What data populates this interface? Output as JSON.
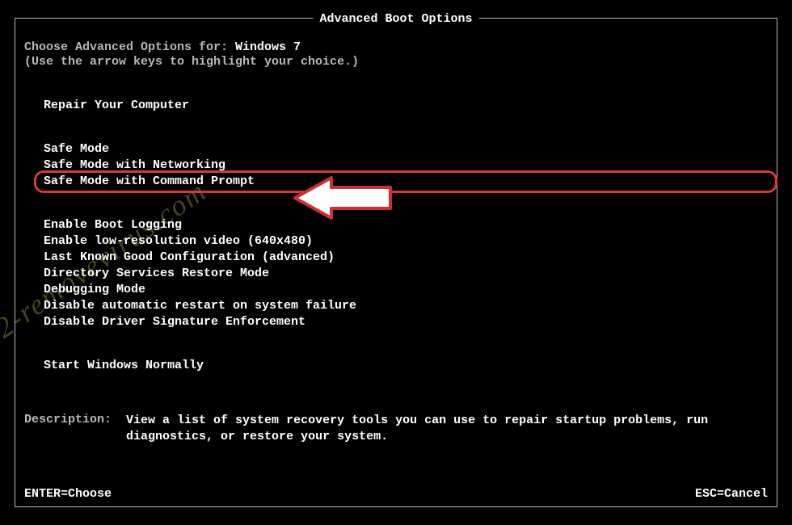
{
  "title": "Advanced Boot Options",
  "prompt": {
    "prefix": "Choose Advanced Options for: ",
    "os": "Windows 7",
    "hint": "(Use the arrow keys to highlight your choice.)"
  },
  "menu": {
    "repair": "Repair Your Computer",
    "group1": [
      "Safe Mode",
      "Safe Mode with Networking",
      "Safe Mode with Command Prompt"
    ],
    "group2": [
      "Enable Boot Logging",
      "Enable low-resolution video (640x480)",
      "Last Known Good Configuration (advanced)",
      "Directory Services Restore Mode",
      "Debugging Mode",
      "Disable automatic restart on system failure",
      "Disable Driver Signature Enforcement"
    ],
    "normal": "Start Windows Normally",
    "selected_index": 2
  },
  "description": {
    "label": "Description:",
    "text": "View a list of system recovery tools you can use to repair startup problems, run diagnostics, or restore your system."
  },
  "footer": {
    "enter": "ENTER=Choose",
    "esc": "ESC=Cancel"
  },
  "watermark": "2-removevirus.com"
}
